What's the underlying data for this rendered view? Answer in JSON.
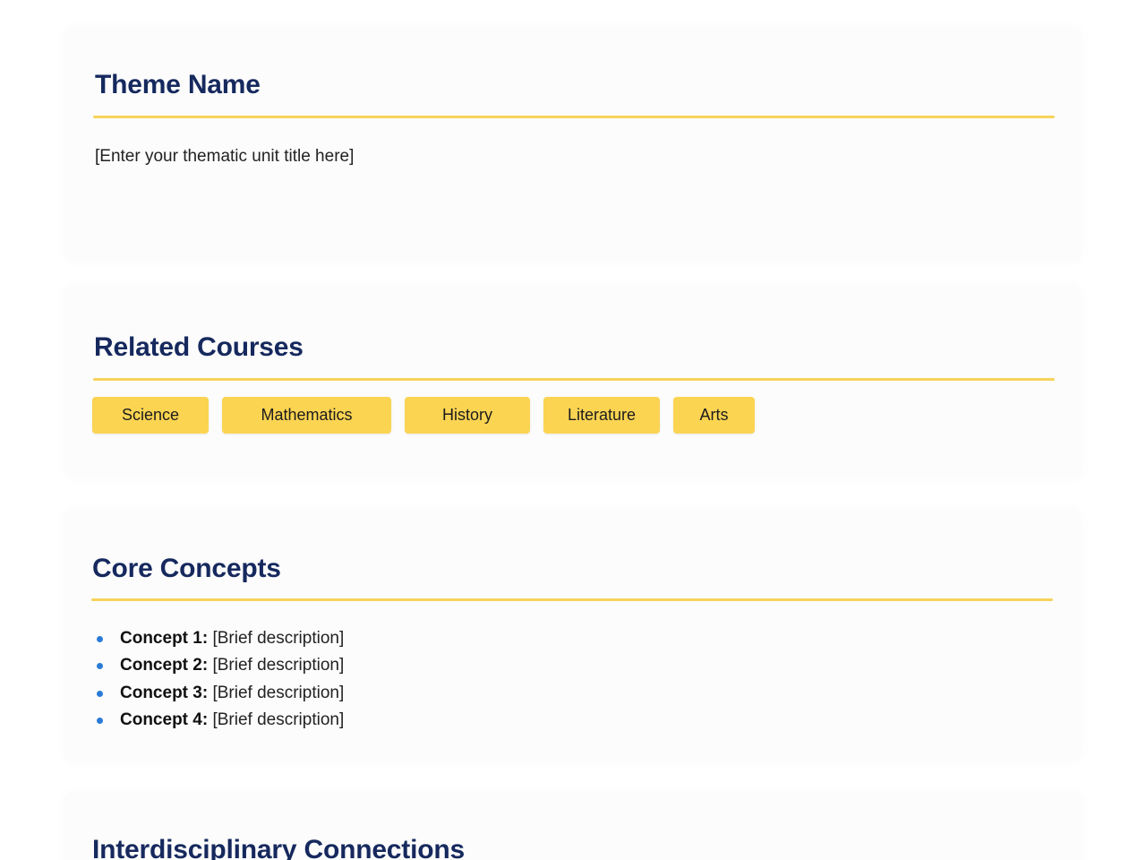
{
  "theme": {
    "heading": "Theme Name",
    "placeholder_text": "[Enter your thematic unit title here]"
  },
  "courses": {
    "heading": "Related Courses",
    "tags": [
      "Science",
      "Mathematics",
      "History",
      "Literature",
      "Arts"
    ]
  },
  "core": {
    "heading": "Core Concepts",
    "items": [
      {
        "label": "Concept 1:",
        "text": " [Brief description]"
      },
      {
        "label": "Concept 2:",
        "text": " [Brief description]"
      },
      {
        "label": "Concept 3:",
        "text": " [Brief description]"
      },
      {
        "label": "Concept 4:",
        "text": " [Brief description]"
      }
    ]
  },
  "interdisciplinary": {
    "heading": "Interdisciplinary Connections"
  },
  "colors": {
    "heading": "#16295e",
    "accent_rule": "#f7d35c",
    "tag_background": "#fbd452",
    "bullet": "#2a7bd6"
  }
}
